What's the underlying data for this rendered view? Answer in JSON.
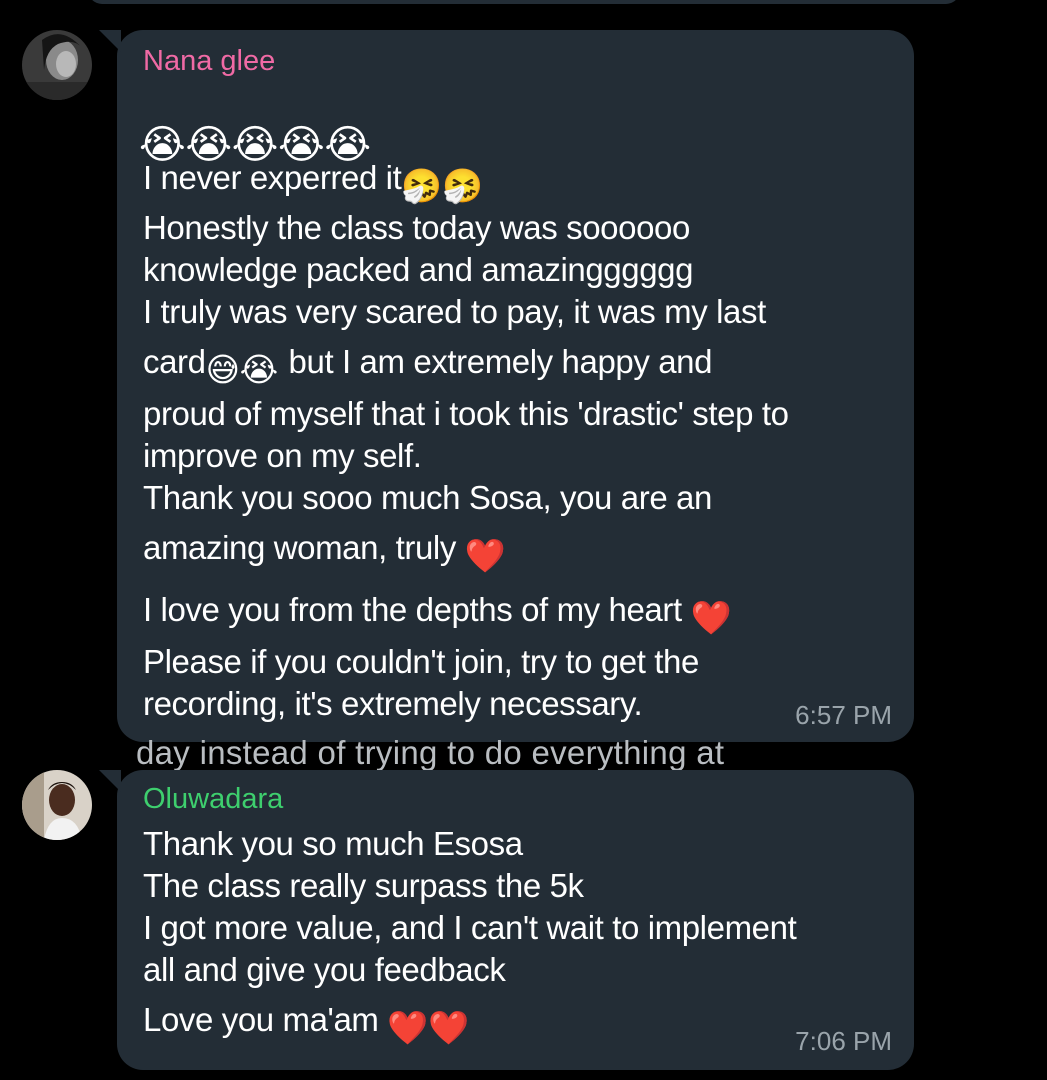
{
  "messages": [
    {
      "sender": "Nana glee",
      "sender_color": "#f06aa5",
      "avatar": "profile-photo-dark-portrait",
      "crying_emoji_row": "😭😭😭😭😭",
      "line1_text": "I never experred it",
      "line1_emoji": "🤧🤧",
      "line2": "Honestly the class today was soooooo",
      "line3": "knowledge packed and amazingggggg",
      "line4": "I truly was very scared to pay, it was my last",
      "line5_text_a": "card",
      "line5_emoji": "😅😭",
      "line5_text_b": " but I am extremely happy and",
      "line6": "proud of myself that i took this 'drastic' step to",
      "line7": "improve on my self.",
      "line8": "Thank you sooo much Sosa, you are an",
      "line9_text": "amazing woman, truly ",
      "line9_emoji": "❤️",
      "line10_text": "I love you from the depths of my heart ",
      "line10_emoji": "❤️",
      "line11": "Please if you couldn't join, try to get the",
      "line12": "recording, it's extremely necessary.",
      "time": "6:57 PM"
    },
    {
      "sender": "Oluwadara",
      "sender_color": "#3ecf6e",
      "avatar": "profile-photo-person-smiling",
      "line1": "Thank you so much Esosa",
      "line2": "The class really surpass the 5k",
      "line3": "I got more value,  and I can't wait to implement",
      "line4": "all and give you feedback",
      "line5_text": "Love you ma'am ",
      "line5_emoji": "❤️❤️",
      "time": "7:06 PM"
    }
  ],
  "background_text": "day instead of trying to do everything at",
  "colors": {
    "background": "#000000",
    "bubble": "#232d36",
    "message_text": "#ffffff",
    "timestamp": "#9aa4ab",
    "heart": "#e8232e"
  }
}
